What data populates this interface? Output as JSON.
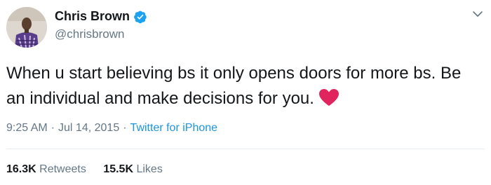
{
  "user": {
    "name": "Chris Brown",
    "handle": "@chrisbrown",
    "verified": true
  },
  "tweet": {
    "text": "When u start believing bs it only opens doors for more bs. Be an individual and make decisions for you.",
    "emoji": "heart-icon"
  },
  "meta": {
    "time": "9:25 AM",
    "separator": "·",
    "date": "Jul 14, 2015",
    "source": "Twitter for iPhone"
  },
  "stats": {
    "retweets_count": "16.3K",
    "retweets_label": "Retweets",
    "likes_count": "15.5K",
    "likes_label": "Likes"
  },
  "colors": {
    "text": "#14171a",
    "secondary": "#657786",
    "link": "#1b95e0",
    "heart": "#e0245e",
    "divider": "#e6ecf0"
  }
}
